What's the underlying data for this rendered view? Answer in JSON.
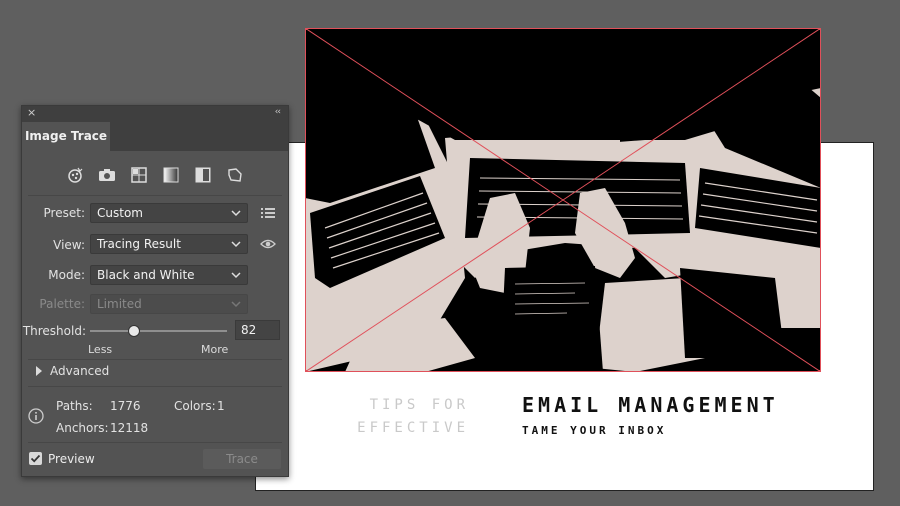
{
  "canvas": {
    "tips_lines": [
      "TIPS FOR",
      "EFFECTIVE"
    ],
    "headline": "EMAIL MANAGEMENT",
    "subline": "TAME YOUR INBOX",
    "bounding_box_color": "#e0505a",
    "trace_colors": {
      "dark": "#000000",
      "light": "#ddd2cc"
    }
  },
  "panel": {
    "title": "Image Trace",
    "close_glyph": "×",
    "collapse_glyph": "‹‹",
    "preset_buttons": [
      "auto-color-icon",
      "camera-icon",
      "grid-icon",
      "grayscale-gradient-icon",
      "black-white-icon",
      "outline-icon"
    ],
    "preset": {
      "label": "Preset:",
      "value": "Custom"
    },
    "view": {
      "label": "View:",
      "value": "Tracing Result"
    },
    "mode": {
      "label": "Mode:",
      "value": "Black and White"
    },
    "palette": {
      "label": "Palette:",
      "value": "Limited"
    },
    "threshold": {
      "label": "Threshold:",
      "value": "82",
      "min_label": "Less",
      "max_label": "More",
      "level": 82,
      "max": 255
    },
    "advanced_label": "Advanced",
    "stats": {
      "paths_label": "Paths:",
      "paths_value": "1776",
      "colors_label": "Colors:",
      "colors_value": "1",
      "anchors_label": "Anchors:",
      "anchors_value": "12118"
    },
    "preview_label": "Preview",
    "preview_checked": true,
    "trace_button": "Trace"
  }
}
